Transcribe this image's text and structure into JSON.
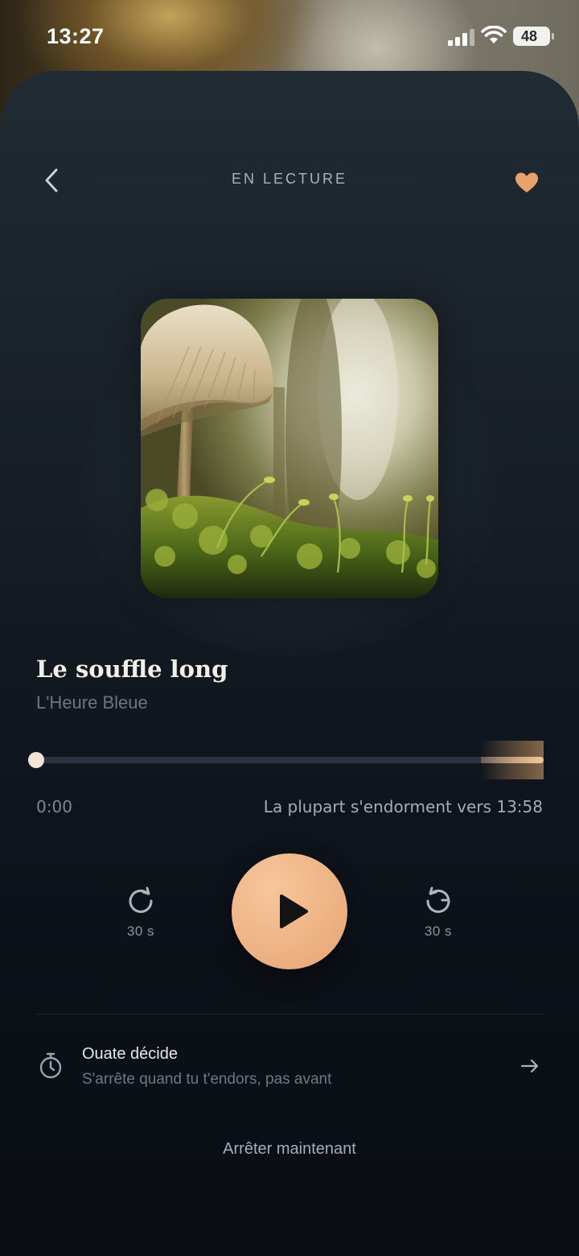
{
  "status_bar": {
    "time": "13:27",
    "battery": "48"
  },
  "header": {
    "title": "EN LECTURE",
    "back_icon": "chevron-left-icon",
    "favorite_icon": "heart-icon"
  },
  "track": {
    "title": "Le souffle long",
    "artist": "L'Heure Bleue"
  },
  "progress": {
    "fraction": 0.0,
    "current_time": "0:00",
    "sleep_estimate": "La plupart s'endorment vers 13:58"
  },
  "controls": {
    "skip_back_label": "30 s",
    "skip_forward_label": "30 s",
    "skip_back_icon": "rotate-ccw-icon",
    "skip_forward_icon": "rotate-cw-icon",
    "play_icon": "play-icon"
  },
  "sleep_timer": {
    "title": "Ouate décide",
    "subtitle": "S'arrête quand tu t'endors, pas avant",
    "icon": "stopwatch-icon"
  },
  "stop_label": "Arrêter maintenant",
  "colors": {
    "accent": "#eeb486",
    "background": "#0b0f15",
    "heart": "#e8a26b"
  }
}
